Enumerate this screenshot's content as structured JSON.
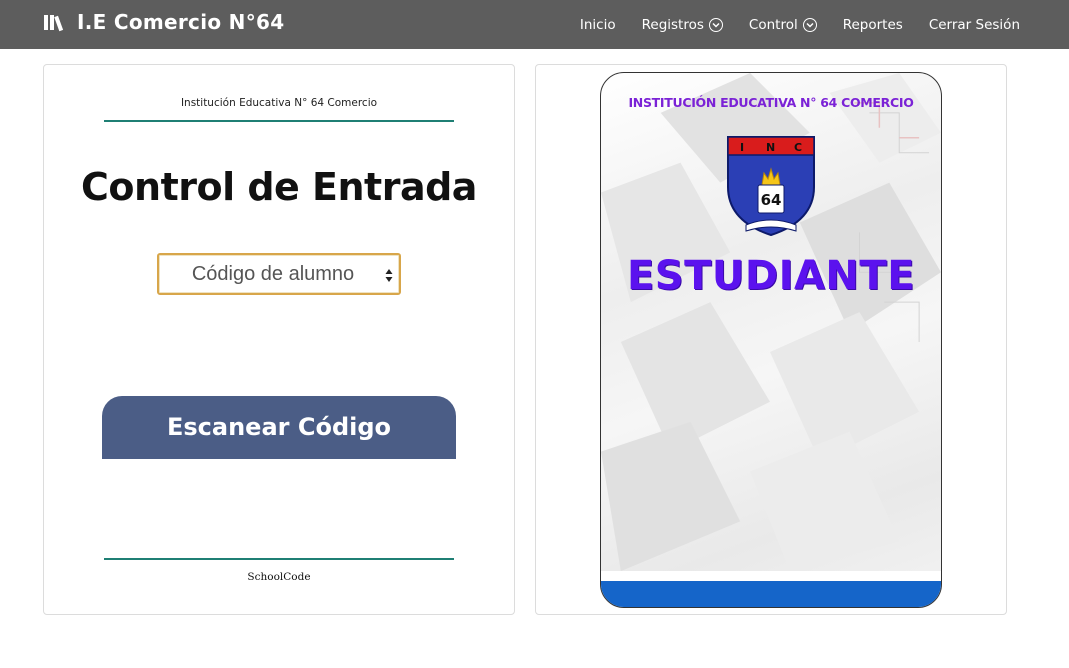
{
  "navbar": {
    "brand_icon": "library-books-icon",
    "brand": "I.E Comercio N°64",
    "items": [
      {
        "label": "Inicio",
        "dropdown": false
      },
      {
        "label": "Registros",
        "dropdown": true
      },
      {
        "label": "Control",
        "dropdown": true
      },
      {
        "label": "Reportes",
        "dropdown": false
      },
      {
        "label": "Cerrar Sesión",
        "dropdown": false
      }
    ]
  },
  "entry_panel": {
    "institution": "Institución Educativa N° 64 Comercio",
    "title": "Control de Entrada",
    "code_input": {
      "placeholder": "Código de alumno",
      "value": ""
    },
    "scan_button": "Escanear Código",
    "footer": "SchoolCode"
  },
  "student_card": {
    "institution": "INSTITUCIÓN EDUCATIVA N° 64 COMERCIO",
    "logo_letters": [
      "I",
      "N",
      "C"
    ],
    "logo_number": "64",
    "role": "ESTUDIANTE"
  },
  "colors": {
    "navbar": "#5d5d5d",
    "teal_line": "#1f7f74",
    "scan_button": "#4b5d86",
    "card_purple": "#7b22d6",
    "card_blue_band": "#1565c9"
  }
}
